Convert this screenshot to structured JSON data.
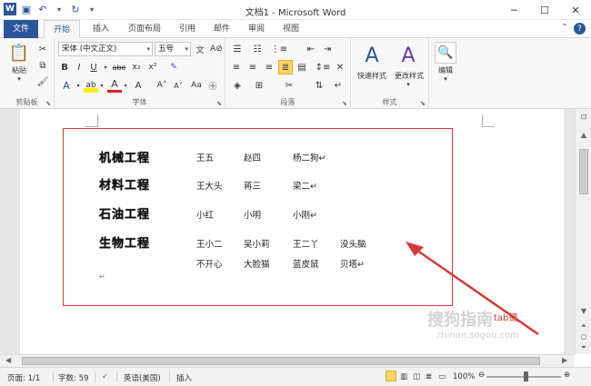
{
  "titlebar": {
    "app_letter": "W",
    "title": "文档1 - Microsoft Word",
    "minimize": "─",
    "restore": "☐",
    "close": "✕"
  },
  "tabs": {
    "file": "文件",
    "items": [
      "开始",
      "插入",
      "页面布局",
      "引用",
      "邮件",
      "审阅",
      "视图"
    ],
    "help": "?"
  },
  "ribbon": {
    "clipboard": {
      "label": "剪贴板",
      "paste": "粘贴"
    },
    "font": {
      "label": "字体",
      "font_name": "宋体 (中文正文)",
      "font_size": "五号",
      "bold": "B",
      "italic": "I",
      "underline": "U",
      "strike": "abe",
      "subscript": "x₂",
      "superscript": "x²",
      "grow": "A˄",
      "shrink": "A˅",
      "aa": "Aa"
    },
    "paragraph": {
      "label": "段落"
    },
    "styles": {
      "label": "样式",
      "quick_styles": "快速样式",
      "change_styles": "更改样式"
    },
    "editing": {
      "label": "",
      "edit": "编辑"
    }
  },
  "document": {
    "rows": [
      {
        "heading": "机械工程",
        "cells": [
          "王五",
          "赵四",
          "杨二狗↵"
        ]
      },
      {
        "heading": "材料工程",
        "cells": [
          "王大头",
          "蒋三",
          "梁二↵"
        ]
      },
      {
        "heading": "石油工程",
        "cells": [
          "小红",
          "小明",
          "小刚↵"
        ]
      },
      {
        "heading": "生物工程",
        "cells": [
          "王小二",
          "吴小莉",
          "王二丫",
          "没头脑"
        ]
      }
    ],
    "continuation": [
      "不开心",
      "大脸猫",
      "蓝皮鼠",
      "贝塔↵"
    ],
    "para_mark": "↵"
  },
  "annotation": "tab键",
  "watermark": {
    "line1": "搜狗指南",
    "line2": "zhinan.sogou.com"
  },
  "status": {
    "page": "页面: 1/1",
    "words": "字数: 59",
    "language": "英语(美国)",
    "mode": "插入",
    "zoom": "100%"
  },
  "colors": {
    "brand": "#2b579a",
    "annotation": "#d33a3a"
  }
}
